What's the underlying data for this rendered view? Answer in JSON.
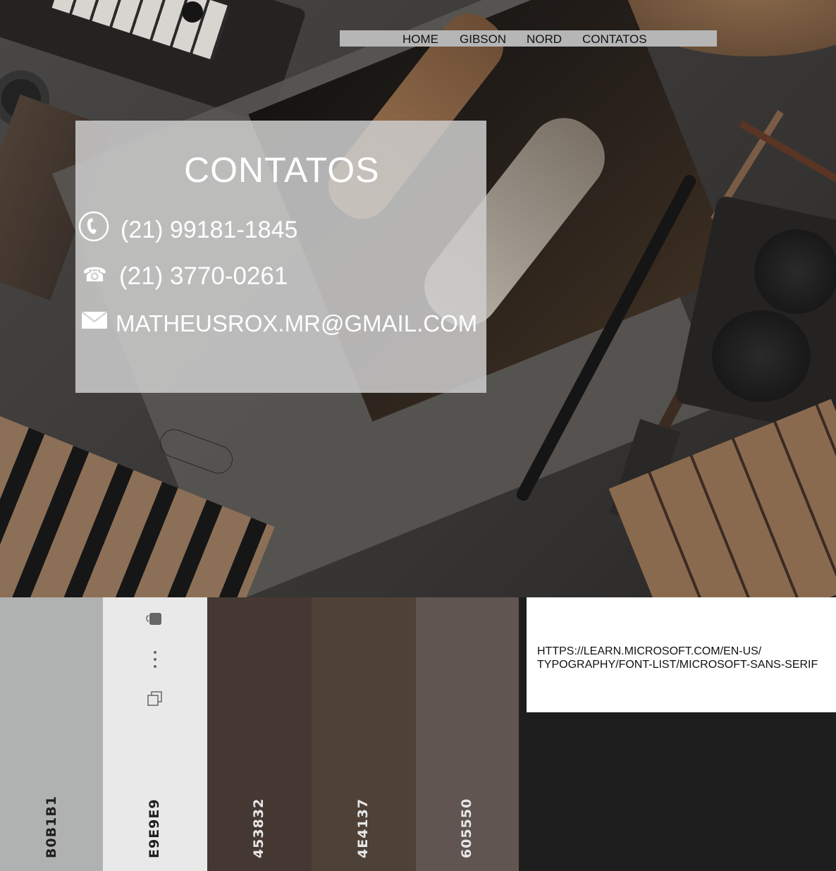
{
  "nav": {
    "items": [
      "HOME",
      "GIBSON",
      "NORD",
      "CONTATOS"
    ]
  },
  "contact": {
    "title": "CONTATOS",
    "rows": [
      {
        "icon": "mobile-phone-icon",
        "text": "(21) 99181-1845"
      },
      {
        "icon": "telephone-icon",
        "text": "(21) 3770-0261"
      },
      {
        "icon": "envelope-icon",
        "text": "MATHEUSROX.MR@GMAIL.COM"
      }
    ]
  },
  "palette": {
    "swatches": [
      {
        "code": "B0B1B1",
        "color": "#b0b1b1"
      },
      {
        "code": "E9E9E9",
        "color": "#e9e9e9"
      },
      {
        "code": "453832",
        "color": "#453832"
      },
      {
        "code": "4E4137",
        "color": "#4e4137"
      },
      {
        "code": "605550",
        "color": "#605550"
      }
    ],
    "tool_icons": [
      "tag-icon",
      "more-vertical-icon",
      "duplicate-icon"
    ]
  },
  "font_reference": {
    "line1": "HTTPS://LEARN.MICROSOFT.COM/EN-US/",
    "line2": "TYPOGRAPHY/FONT-LIST/MICROSOFT-SANS-SERIF"
  }
}
